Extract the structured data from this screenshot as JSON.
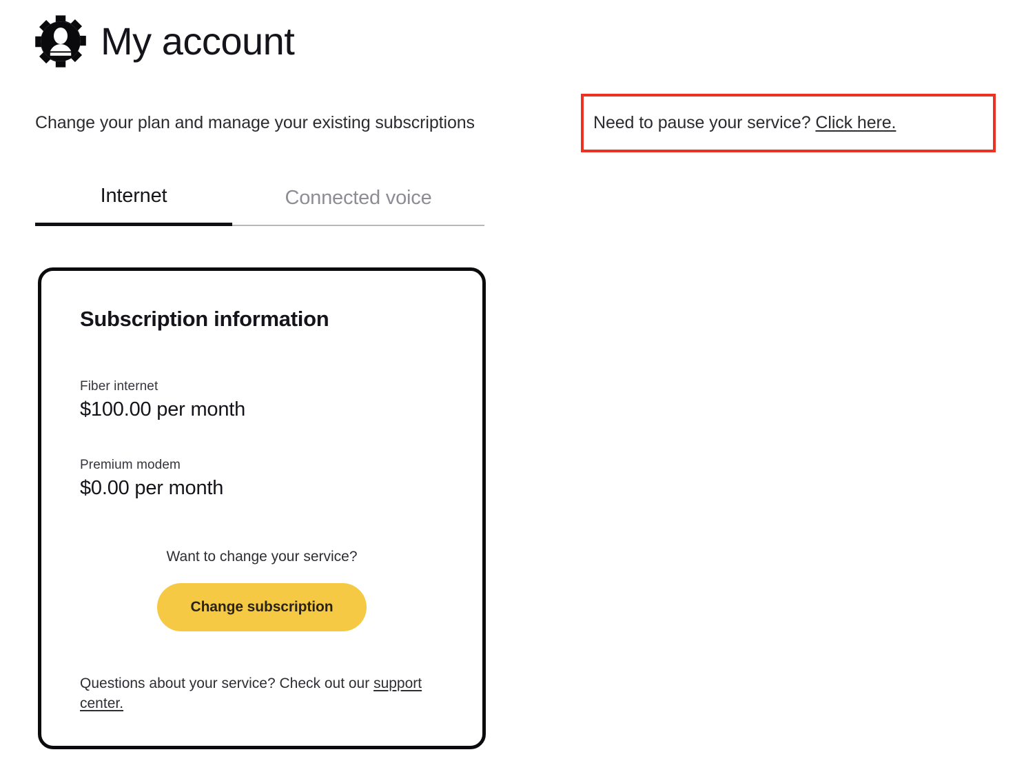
{
  "header": {
    "icon": "account-gear-icon",
    "title": "My account"
  },
  "subtitle": {
    "text": "Change your plan and manage your existing subscriptions"
  },
  "callout": {
    "border_color": "#ec3223",
    "question": "Need to pause your service?",
    "link_label": "Click here."
  },
  "tabs": [
    {
      "label": "Internet",
      "active": true
    },
    {
      "label": "Connected voice",
      "active": false
    }
  ],
  "card": {
    "title": "Subscription information",
    "plans": [
      {
        "name": "Fiber internet",
        "price": "$100.00 per month"
      },
      {
        "name": "Premium modem",
        "price": "$0.00 per month"
      }
    ],
    "change_prompt": "Want to change your service?",
    "change_button_label": "Change subscription",
    "button_color": "#f5c943",
    "support_note": "Questions about your service? Check out our",
    "support_link_label": "support center."
  }
}
